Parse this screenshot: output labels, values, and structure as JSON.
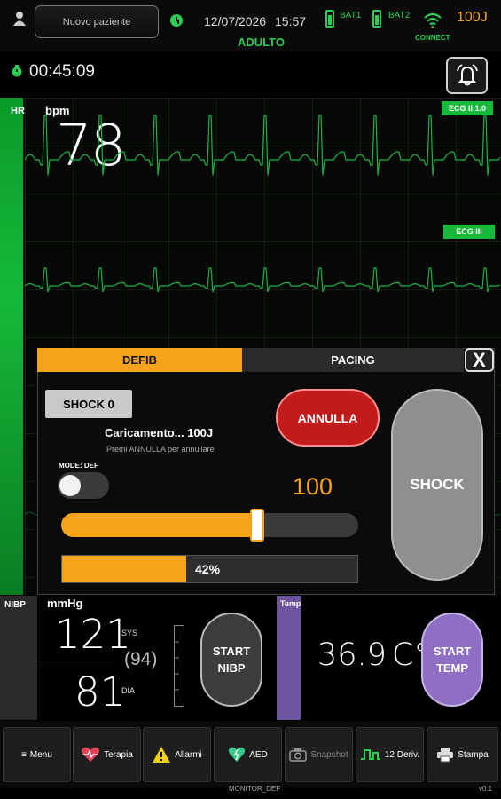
{
  "header": {
    "patient_button": "Nuovo paziente",
    "date": "12/07/2026",
    "time": "15:57",
    "bat1": "BAT1",
    "bat2": "BAT2",
    "connect": "CONNECT",
    "energy": "100J",
    "mode": "ADULTO"
  },
  "timer": "00:45:09",
  "hr": {
    "label": "HR",
    "unit": "bpm",
    "value": "78",
    "lead1": "ECG II  1.0",
    "lead2": "ECG III"
  },
  "defib": {
    "tab_defib": "DEFIB",
    "tab_pacing": "PACING",
    "close": "X",
    "shock_count": "SHOCK 0",
    "cancel": "ANNULLA",
    "charging": "Caricamento... 100J",
    "charging_hint": "Premi ANNULLA per annullare",
    "mode_label": "MODE: DEF",
    "energy_value": "100",
    "energy_fraction": 0.66,
    "charge_progress": 0.42,
    "charge_text": "42%",
    "shock": "SHOCK"
  },
  "nibp": {
    "label": "NIBP",
    "unit": "mmHg",
    "sys": "121",
    "sys_label": "SYS",
    "mean": "(94)",
    "dia": "81",
    "dia_label": "DIA",
    "start": "START NIBP"
  },
  "temp": {
    "label": "Temp",
    "value": "36.9",
    "unit": "C°",
    "start": "START TEMP"
  },
  "menu": [
    {
      "label": "Menu",
      "icon": "menu-icon"
    },
    {
      "label": "Terapia",
      "icon": "heart-pulse-icon"
    },
    {
      "label": "Allarmi",
      "icon": "warning-icon"
    },
    {
      "label": "AED",
      "icon": "heart-aed-icon"
    },
    {
      "label": "Snapshot",
      "icon": "camera-icon"
    },
    {
      "label": "12 Deriv.",
      "icon": "wave-icon"
    },
    {
      "label": "Stampa",
      "icon": "printer-icon"
    }
  ],
  "footer": {
    "label": "MONITOR_DEF",
    "version": "v0.1"
  },
  "colors": {
    "accent": "#f5a31a",
    "green": "#16b93a",
    "danger": "#c11b1b",
    "temp": "#8e6fc4"
  }
}
